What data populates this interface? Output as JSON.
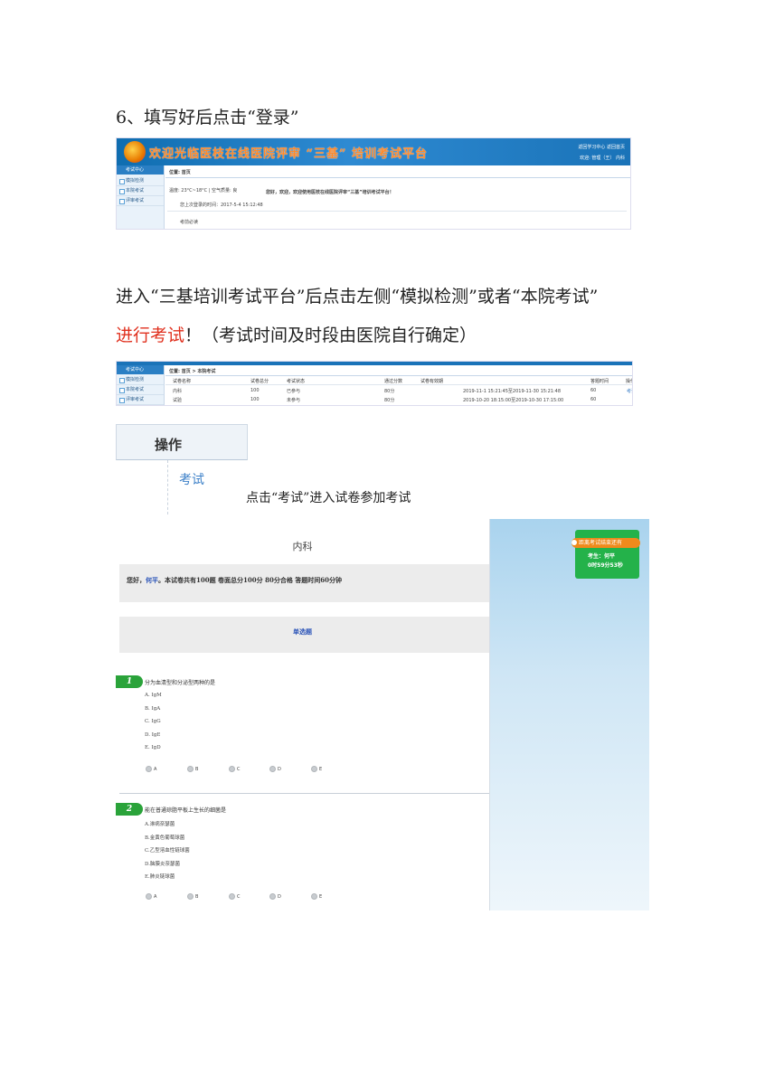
{
  "step_heading": "6、填写好后点击“登录”",
  "shot1": {
    "banner_title": "欢迎光临医枝在线医院评审 “三基” 培训考试平台",
    "top_right_1": "返回学习中心   返回首页",
    "top_right_2": "欢迎: 管理（王）  内科",
    "sidebar_header": "考试中心",
    "sidebar_items": [
      "模拟检测",
      "本院考试",
      "评审考试"
    ],
    "breadcrumb": "位置: 首页",
    "weather": "温度: 23°C~18°C | 空气质量: 良",
    "last_login": "您上次登录的时间：2017-5-4 15:12:48",
    "welcome": "您好，欢迎，欢迎使用医枝在线医院评审“三基”培训考试平台！",
    "notice": "考前必读"
  },
  "para2_line1": "进入“三基培训考试平台”后点击左侧“模拟检测”或者“本院考试”",
  "para2_red": "进行考试",
  "para2_rest": "！（考试时间及时段由医院自行确定）",
  "shot2": {
    "sidebar_header": "考试中心",
    "sidebar_items": [
      "模拟检测",
      "本院考试",
      "评审考试"
    ],
    "breadcrumb": "位置: 首页 > 本院考试",
    "headers": [
      "试卷名称",
      "试卷总分",
      "考试状态",
      "通过分数",
      "试卷有效期",
      "答题时间",
      "操作"
    ],
    "rows": [
      [
        "内科",
        "100",
        "已参与",
        "80分",
        "2019-11-1 15:21:45至2019-11-30 15:21:48",
        "60",
        "考试"
      ],
      [
        "试验",
        "100",
        "未参与",
        "80分",
        "2019-10-20 18:15:00至2019-10-30 17:15:00",
        "60",
        ""
      ]
    ]
  },
  "zoom": {
    "header": "操作",
    "link": "考试"
  },
  "caption": "点击“考试”进入试卷参加考试",
  "exam": {
    "title": "内科",
    "welcome_prefix": "您好，",
    "welcome_name": "何平",
    "welcome_rest": "。本试卷共有100题   卷面总分100分   80分合格   答题时间60分钟",
    "section": "单选题",
    "timer_head": "距离考试结束还有",
    "timer_examinee": "考生：何平",
    "timer_time": "0时59分53秒",
    "questions": [
      {
        "num": "1",
        "text": "分为血清型和分泌型两种的是",
        "options": [
          "A. IgM",
          "B. IgA",
          "C. IgG",
          "D. IgE",
          "E. IgD"
        ],
        "choices": [
          "A",
          "B",
          "C",
          "D",
          "E"
        ]
      },
      {
        "num": "2",
        "text": "能在普通琼脂平板上生长的细菌是",
        "options": [
          "A.淋病奈瑟菌",
          "B.金黄色葡萄球菌",
          "C.乙型溶血性链球菌",
          "D.脑膜炎奈瑟菌",
          "E.肺炎链球菌"
        ],
        "choices": [
          "A",
          "B",
          "C",
          "D",
          "E"
        ]
      }
    ]
  }
}
